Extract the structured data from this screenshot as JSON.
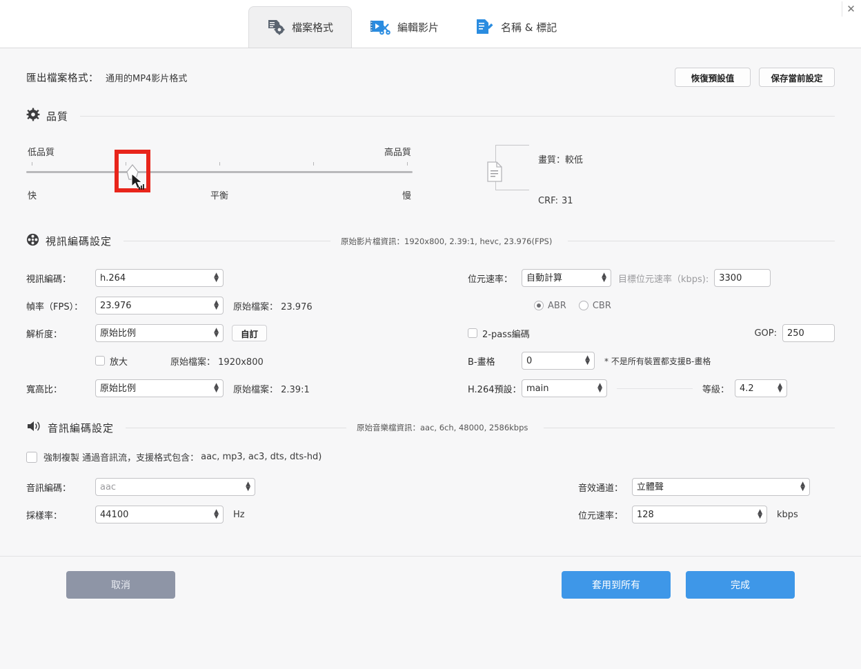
{
  "window": {
    "close_icon": "close-icon"
  },
  "tabs": [
    {
      "label": "檔案格式",
      "icon": "file-format-icon",
      "active": true
    },
    {
      "label": "編輯影片",
      "icon": "edit-video-icon",
      "active": false
    },
    {
      "label": "名稱 & 標記",
      "icon": "name-tag-icon",
      "active": false
    }
  ],
  "export": {
    "label": "匯出檔案格式：",
    "value": "通用的MP4影片格式",
    "restore_defaults": "恢復預設值",
    "save_preset": "保存當前設定"
  },
  "quality": {
    "section_title": "品質",
    "section_icon": "gear-icon",
    "low_label": "低品質",
    "high_label": "高品質",
    "fast_label": "快",
    "balanced_label": "平衡",
    "slow_label": "慢",
    "slider_percent": 26,
    "image_quality_label": "畫質：",
    "image_quality_value": "較低",
    "crf_label": "CRF:",
    "crf_value": "31",
    "doc_icon": "document-icon",
    "highlight_color": "#e8251b"
  },
  "video": {
    "section_title": "視訊編碼設定",
    "section_icon": "film-reel-icon",
    "source_info": "原始影片檔資訊：1920x800, 2.39:1, hevc, 23.976(FPS)",
    "codec_label": "視訊編碼：",
    "codec_value": "h.264",
    "fps_label": "幀率（FPS）：",
    "fps_value": "23.976",
    "fps_source": "原始檔案： 23.976",
    "resolution_label": "解析度：",
    "resolution_value": "原始比例",
    "custom_button": "自訂",
    "upscale_label": "放大",
    "upscale_checked": false,
    "resolution_source": "原始檔案： 1920x800",
    "aspect_label": "寬高比：",
    "aspect_value": "原始比例",
    "aspect_source": "原始檔案： 2.39:1",
    "bitrate_label": "位元速率：",
    "bitrate_value": "自動計算",
    "target_bitrate_label": "目標位元速率（kbps):",
    "target_bitrate_value": "3300",
    "abr_label": "ABR",
    "cbr_label": "CBR",
    "rate_mode": "ABR",
    "twopass_label": "2-pass編碼",
    "twopass_checked": false,
    "gop_label": "GOP:",
    "gop_value": "250",
    "bframe_label": "B-畫格",
    "bframe_value": "0",
    "bframe_note": "* 不是所有裝置都支援B-畫格",
    "preset_label": "H.264預設：",
    "preset_value": "main",
    "level_label": "等級：",
    "level_value": "4.2"
  },
  "audio": {
    "section_title": "音訊編碼設定",
    "section_icon": "speaker-icon",
    "source_info": "原始音樂檔資訊：aac, 6ch, 48000, 2586kbps",
    "copy_checked": false,
    "copy_label": "強制複製 通過音訊流，支援格式包含：",
    "copy_formats": "aac, mp3, ac3, dts, dts-hd)",
    "codec_label": "音訊編碼：",
    "codec_value": "aac",
    "samplerate_label": "採樣率：",
    "samplerate_value": "44100",
    "samplerate_unit": "Hz",
    "channel_label": "音效通道：",
    "channel_value": "立體聲",
    "bitrate_label": "位元速率：",
    "bitrate_value": "128",
    "bitrate_unit": "kbps"
  },
  "footer": {
    "cancel": "取消",
    "apply_all": "套用到所有",
    "done": "完成"
  }
}
